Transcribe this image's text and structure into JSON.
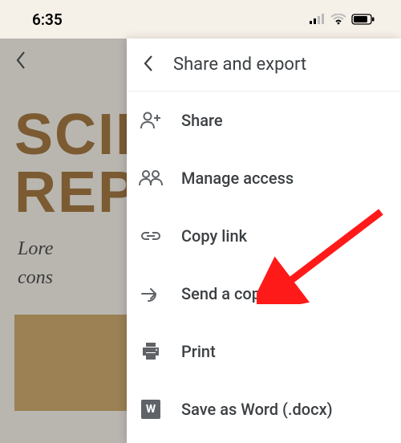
{
  "status": {
    "time": "6:35"
  },
  "background": {
    "title_line1": "SCIE",
    "title_line2": "REPO",
    "sub_line1": "Lore",
    "sub_line2": "cons"
  },
  "panel": {
    "title": "Share and export",
    "items": [
      {
        "icon": "person-add-icon",
        "label": "Share"
      },
      {
        "icon": "people-icon",
        "label": "Manage access"
      },
      {
        "icon": "link-icon",
        "label": "Copy link"
      },
      {
        "icon": "send-icon",
        "label": "Send a copy"
      },
      {
        "icon": "print-icon",
        "label": "Print"
      },
      {
        "icon": "word-icon",
        "label": "Save as Word (.docx)"
      }
    ]
  },
  "word_icon_letter": "W"
}
